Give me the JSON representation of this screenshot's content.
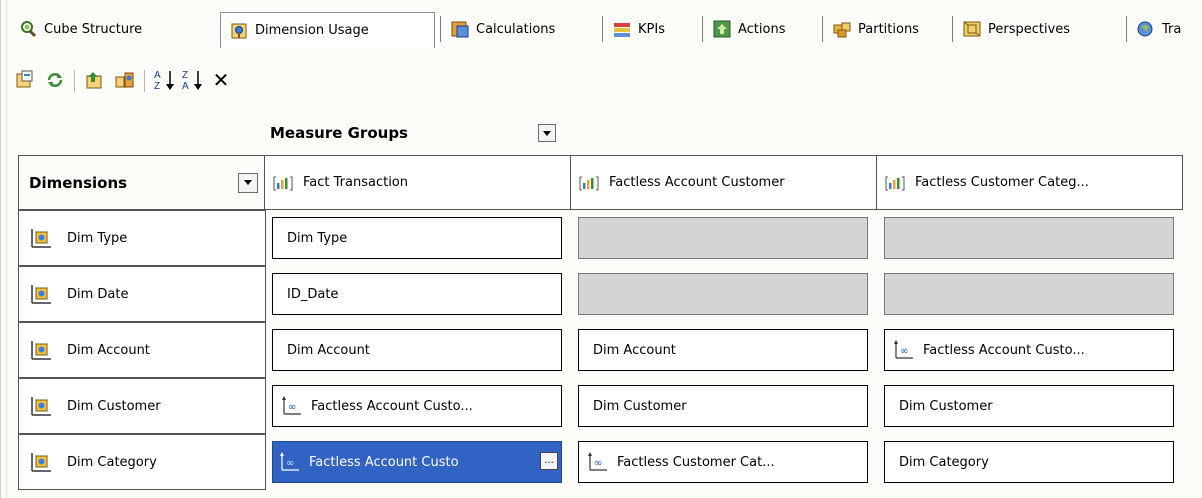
{
  "tabs": [
    {
      "label": "Cube Structure",
      "icon": "cube-structure-icon",
      "active": false
    },
    {
      "label": "Dimension Usage",
      "icon": "dimension-usage-icon",
      "active": true
    },
    {
      "label": "Calculations",
      "icon": "calculations-icon",
      "active": false
    },
    {
      "label": "KPIs",
      "icon": "kpis-icon",
      "active": false
    },
    {
      "label": "Actions",
      "icon": "actions-icon",
      "active": false
    },
    {
      "label": "Partitions",
      "icon": "partitions-icon",
      "active": false
    },
    {
      "label": "Perspectives",
      "icon": "perspectives-icon",
      "active": false
    },
    {
      "label": "Tra",
      "icon": "translations-icon",
      "active": false
    }
  ],
  "toolbar": {
    "buttons": [
      "add-cube-dimension-icon",
      "refresh-icon",
      "show-all-dimensions-icon",
      "add-measure-group-icon",
      "sort-ascending-icon",
      "sort-descending-icon",
      "delete-icon"
    ],
    "sort_asc_top": "A",
    "sort_asc_bottom": "Z",
    "sort_desc_top": "Z",
    "sort_desc_bottom": "A",
    "delete_glyph": "✕"
  },
  "grid": {
    "measure_groups_label": "Measure Groups",
    "dimensions_label": "Dimensions",
    "measure_groups": [
      "Fact Transaction",
      "Factless Account Customer",
      "Factless Customer Categ..."
    ],
    "dimensions": [
      "Dim Type",
      "Dim Date",
      "Dim Account",
      "Dim Customer",
      "Dim Category"
    ],
    "cells": [
      [
        {
          "text": "Dim Type",
          "kind": "regular"
        },
        {
          "text": "",
          "kind": "empty"
        },
        {
          "text": "",
          "kind": "empty"
        }
      ],
      [
        {
          "text": "ID_Date",
          "kind": "regular"
        },
        {
          "text": "",
          "kind": "empty"
        },
        {
          "text": "",
          "kind": "empty"
        }
      ],
      [
        {
          "text": "Dim Account",
          "kind": "regular"
        },
        {
          "text": "Dim Account",
          "kind": "regular"
        },
        {
          "text": "Factless Account Custo...",
          "kind": "many-to-many"
        }
      ],
      [
        {
          "text": "Factless Account Custo...",
          "kind": "many-to-many"
        },
        {
          "text": "Dim Customer",
          "kind": "regular"
        },
        {
          "text": "Dim Customer",
          "kind": "regular"
        }
      ],
      [
        {
          "text": "Factless Account Custo",
          "kind": "many-to-many",
          "selected": true
        },
        {
          "text": "Factless Customer Cat...",
          "kind": "many-to-many"
        },
        {
          "text": "Dim Category",
          "kind": "regular"
        }
      ]
    ],
    "ellipsis_label": "..."
  },
  "colors": {
    "selected": "#3163c4",
    "empty_cell": "#d4d4d4",
    "background": "#fcfcf9"
  }
}
